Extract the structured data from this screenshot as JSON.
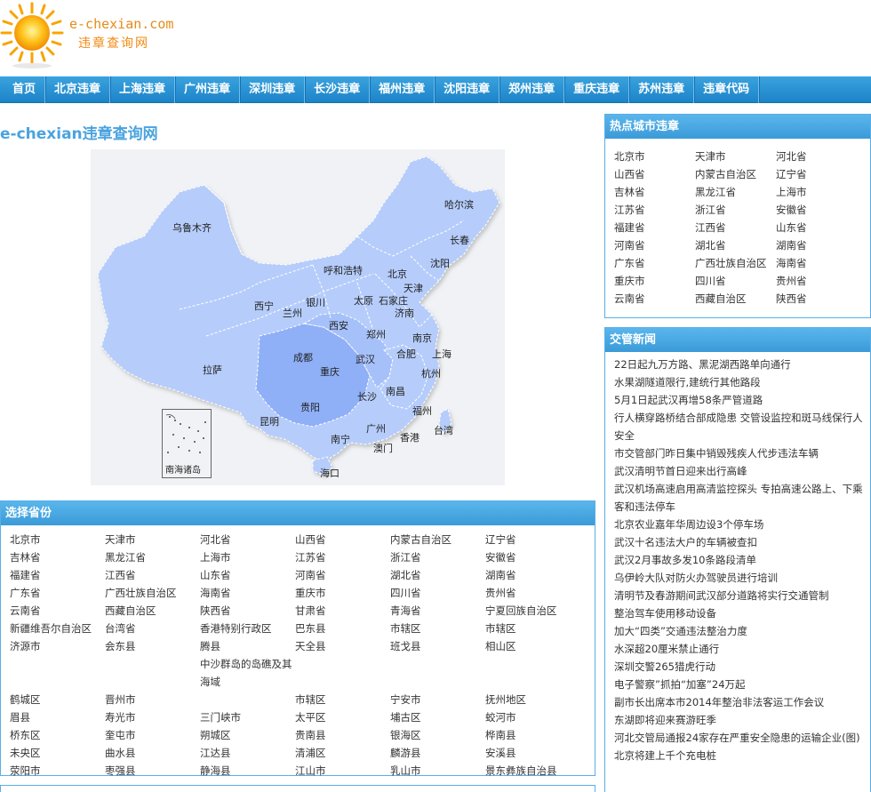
{
  "header": {
    "domain": "e-chexian.com",
    "tagline": "违章查询网"
  },
  "nav": {
    "items": [
      "首页",
      "北京违章",
      "上海违章",
      "广州违章",
      "深圳违章",
      "长沙违章",
      "福州违章",
      "沈阳违章",
      "郑州违章",
      "重庆违章",
      "苏州违章",
      "违章代码"
    ]
  },
  "main": {
    "site_title": "e-chexian违章查询网"
  },
  "map": {
    "cities": [
      "哈尔滨",
      "长春",
      "乌鲁木齐",
      "呼和浩特",
      "沈阳",
      "北京",
      "天津",
      "银川",
      "太原",
      "石家庄",
      "西宁",
      "兰州",
      "济南",
      "西安",
      "郑州",
      "南京",
      "合肥",
      "上海",
      "成都",
      "武汉",
      "拉萨",
      "重庆",
      "杭州",
      "长沙",
      "南昌",
      "贵阳",
      "福州",
      "昆明",
      "广州",
      "台湾",
      "南宁",
      "香港",
      "澳门",
      "海口"
    ],
    "inset_label": "南海诸岛"
  },
  "provinces": {
    "title": "选择省份",
    "items": [
      "北京市",
      "天津市",
      "河北省",
      "山西省",
      "内蒙古自治区",
      "辽宁省",
      "吉林省",
      "黑龙江省",
      "上海市",
      "江苏省",
      "浙江省",
      "安徽省",
      "福建省",
      "江西省",
      "山东省",
      "河南省",
      "湖北省",
      "湖南省",
      "广东省",
      "广西壮族自治区",
      "海南省",
      "重庆市",
      "四川省",
      "贵州省",
      "云南省",
      "西藏自治区",
      "陕西省",
      "甘肃省",
      "青海省",
      "宁夏回族自治区",
      "新疆维吾尔自治区",
      "台湾省",
      "香港特别行政区",
      "巴东县",
      "市辖区",
      "市辖区",
      "济源市",
      "会东县",
      "腾县",
      "天全县",
      "班戈县",
      "相山区",
      "",
      "",
      "中沙群岛的岛礁及其海域",
      "",
      "",
      "",
      "鹤城区",
      "晋州市",
      "",
      "市辖区",
      "宁安市",
      "抚州地区",
      "眉县",
      "寿光市",
      "三门峡市",
      "太平区",
      "埔古区",
      "蛟河市",
      "桥东区",
      "奎屯市",
      "朔城区",
      "贵南县",
      "银海区",
      "桦南县",
      "未央区",
      "曲水县",
      "江达县",
      "清浦区",
      "麟游县",
      "安溪县",
      "荥阳市",
      "枣强县",
      "静海县",
      "江山市",
      "乳山市",
      "景东彝族自治县"
    ]
  },
  "hot_cities": {
    "title": "热点城市违章",
    "items": [
      "北京市",
      "天津市",
      "河北省",
      "山西省",
      "内蒙古自治区",
      "辽宁省",
      "吉林省",
      "黑龙江省",
      "上海市",
      "江苏省",
      "浙江省",
      "安徽省",
      "福建省",
      "江西省",
      "山东省",
      "河南省",
      "湖北省",
      "湖南省",
      "广东省",
      "广西壮族自治区",
      "海南省",
      "重庆市",
      "四川省",
      "贵州省",
      "云南省",
      "西藏自治区",
      "陕西省"
    ]
  },
  "news": {
    "title": "交管新闻",
    "items": [
      "22日起九万方路、黑泥湖西路单向通行",
      "水果湖隧道限行,建统行其他路段",
      "5月1日起武汉再增58条严管道路",
      "行人横穿路桥结合部成隐患 交管设监控和斑马线保行人安全",
      "市交管部门昨日集中销毁残疾人代步违法车辆",
      "武汉清明节首日迎来出行高峰",
      "武汉机场高速启用高清监控探头 专拍高速公路上、下乘客和违法停车",
      "北京农业嘉年华周边设3个停车场",
      "武汉十名违法大户的车辆被查扣",
      "武汉2月事故多发10条路段清单",
      "乌伊岭大队对防火办驾驶员进行培训",
      "清明节及春游期间武汉部分道路将实行交通管制",
      "整治驾车使用移动设备",
      "加大“四类”交通违法整治力度",
      "水深超20厘米禁止通行",
      "深圳交警265猎虎行动",
      "电子警察”抓拍“加塞”24万起",
      "副市长出席本市2014年整治非法客运工作会议",
      "东湖即将迎来赛游旺季",
      "河北交管局通报24家存在严重安全隐患的运输企业(图)",
      "北京将建上千个充电桩"
    ]
  }
}
